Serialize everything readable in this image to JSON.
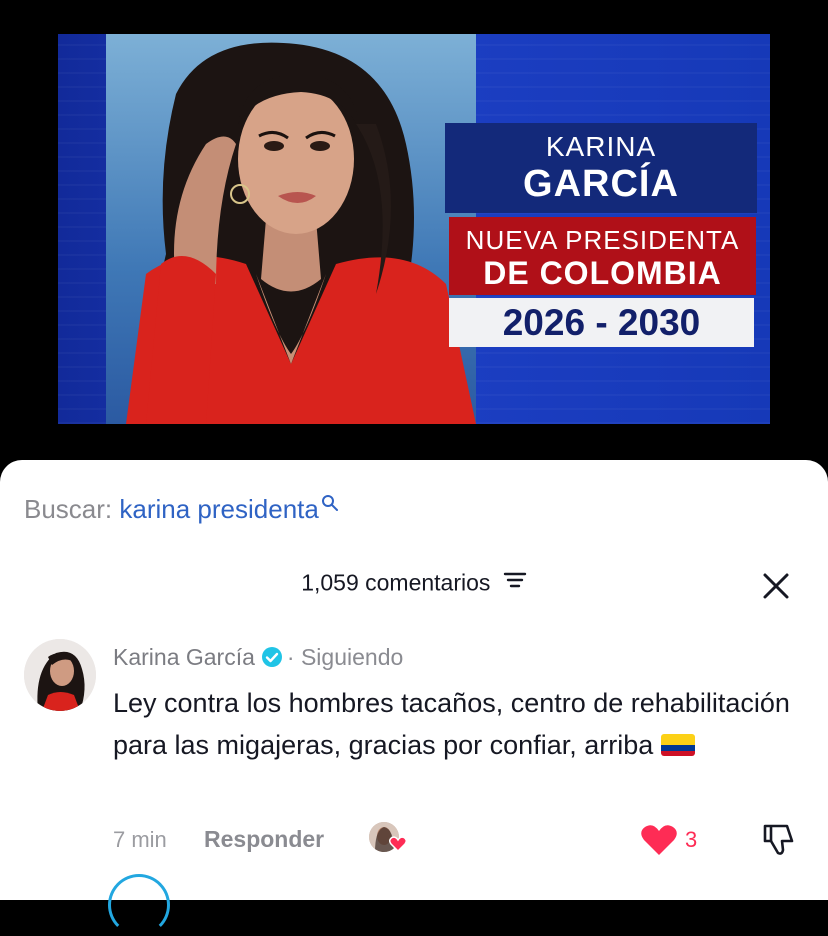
{
  "video": {
    "banner": {
      "name_first": "KARINA",
      "name_last": "GARCÍA",
      "role_line1": "NUEVA PRESIDENTA",
      "role_line2": "DE COLOMBIA",
      "years": "2026 - 2030"
    },
    "colors": {
      "name_box": "#13297a",
      "role_box": "#b01018",
      "years_text": "#12206a"
    }
  },
  "search": {
    "label": "Buscar:",
    "query": "karina presidenta",
    "icon": "search-icon"
  },
  "comments_header": {
    "count_label": "1,059 comentarios",
    "filter_icon": "filter-icon",
    "close_icon": "close-icon"
  },
  "comment": {
    "author": "Karina García",
    "verified": true,
    "separator": "·",
    "follow_status": "Siguiendo",
    "text": "Ley contra los hombres tacaños, centro de rehabilitación para las migajeras, gracias por confiar, arriba",
    "emoji": "colombia-flag",
    "time": "7 min",
    "reply_label": "Responder",
    "like_count": "3",
    "accent_like": "#fe2c55"
  }
}
